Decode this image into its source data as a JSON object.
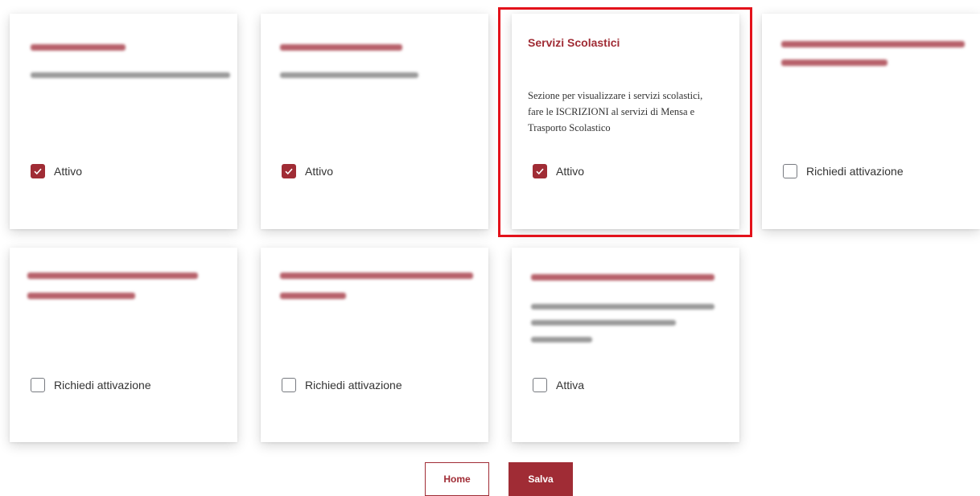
{
  "cards": [
    {
      "title": "",
      "description": "",
      "checkbox_label": "Attivo",
      "checked": true
    },
    {
      "title": "",
      "description": "",
      "checkbox_label": "Attivo",
      "checked": true
    },
    {
      "title": "Servizi Scolastici",
      "description": "Sezione per visualizzare i servizi scolastici, fare le ISCRIZIONI al servizi di Mensa e Trasporto Scolastico",
      "checkbox_label": "Attivo",
      "checked": true
    },
    {
      "title": "",
      "description": "",
      "checkbox_label": "Richiedi attivazione",
      "checked": false
    },
    {
      "title": "",
      "description": "",
      "checkbox_label": "Richiedi attivazione",
      "checked": false
    },
    {
      "title": "",
      "description": "",
      "checkbox_label": "Richiedi attivazione",
      "checked": false
    },
    {
      "title": "",
      "description": "",
      "checkbox_label": "Attiva",
      "checked": false
    }
  ],
  "buttons": {
    "home_label": "Home",
    "save_label": "Salva"
  },
  "colors": {
    "accent": "#a02c35",
    "highlight": "#e3121b"
  }
}
